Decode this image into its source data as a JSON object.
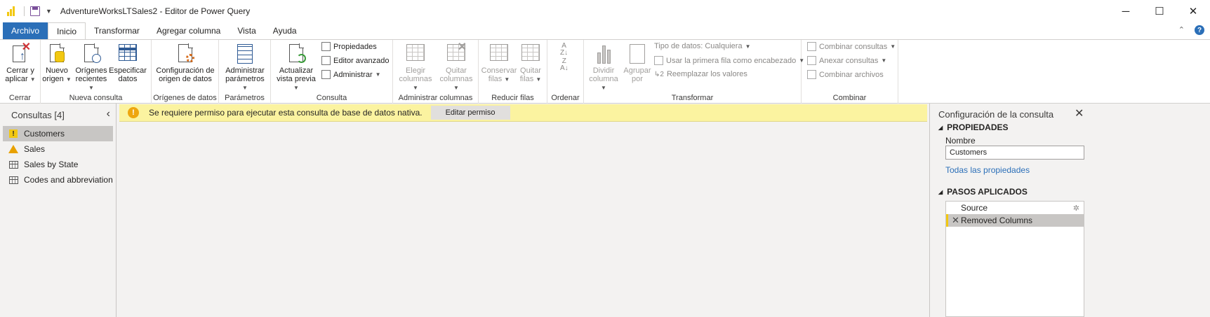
{
  "window": {
    "title": "AdventureWorksLTSales2 - Editor de Power Query",
    "controls": {
      "minimize": "─",
      "maximize": "☐",
      "close": "✕"
    }
  },
  "tabs": [
    {
      "label": "Archivo"
    },
    {
      "label": "Inicio"
    },
    {
      "label": "Transformar"
    },
    {
      "label": "Agregar columna"
    },
    {
      "label": "Vista"
    },
    {
      "label": "Ayuda"
    }
  ],
  "ribbon": {
    "cerrar": {
      "group": "Cerrar",
      "apply_l1": "Cerrar y",
      "apply_l2": "aplicar"
    },
    "nueva": {
      "group": "Nueva consulta",
      "nuevo_l1": "Nuevo",
      "nuevo_l2": "origen",
      "recientes_l1": "Orígenes",
      "recientes_l2": "recientes",
      "especificar_l1": "Especificar",
      "especificar_l2": "datos"
    },
    "origenes": {
      "group": "Orígenes de datos",
      "config_l1": "Configuración de",
      "config_l2": "origen de datos"
    },
    "parametros": {
      "group": "Parámetros",
      "admin_l1": "Administrar",
      "admin_l2": "parámetros"
    },
    "consulta": {
      "group": "Consulta",
      "actualizar_l1": "Actualizar",
      "actualizar_l2": "vista previa",
      "propiedades": "Propiedades",
      "editor": "Editor avanzado",
      "administrar": "Administrar"
    },
    "columnas": {
      "group": "Administrar columnas",
      "elegir_l1": "Elegir",
      "elegir_l2": "columnas",
      "quitar_l1": "Quitar",
      "quitar_l2": "columnas"
    },
    "filas": {
      "group": "Reducir filas",
      "conservar_l1": "Conservar",
      "conservar_l2": "filas",
      "quitar_l1": "Quitar",
      "quitar_l2": "filas"
    },
    "ordenar": {
      "group": "Ordenar"
    },
    "transformar": {
      "group": "Transformar",
      "dividir_l1": "Dividir",
      "dividir_l2": "columna",
      "agrupar_l1": "Agrupar",
      "agrupar_l2": "por",
      "tipo_datos": "Tipo de datos: Cualquiera",
      "primera_fila": "Usar la primera fila como encabezado",
      "reemplazar": "Reemplazar los valores"
    },
    "combinar": {
      "group": "Combinar",
      "combinar_consultas": "Combinar consultas",
      "anexar_consultas": "Anexar consultas",
      "combinar_archivos": "Combinar archivos"
    }
  },
  "queries": {
    "header": "Consultas [4]",
    "items": [
      {
        "label": "Customers",
        "icon": "warning-square-icon"
      },
      {
        "label": "Sales",
        "icon": "warning-triangle-icon"
      },
      {
        "label": "Sales by State",
        "icon": "table-icon"
      },
      {
        "label": "Codes and abbreviations...",
        "icon": "table-icon"
      }
    ]
  },
  "banner": {
    "message": "Se requiere permiso para ejecutar esta consulta de base de datos nativa.",
    "button": "Editar permiso"
  },
  "settings": {
    "title": "Configuración de la consulta",
    "properties_header": "PROPIEDADES",
    "name_label": "Nombre",
    "name_value": "Customers",
    "all_props_link": "Todas las propiedades",
    "steps_header": "PASOS APLICADOS",
    "steps": [
      {
        "label": "Source"
      },
      {
        "label": "Removed Columns"
      }
    ]
  },
  "colors": {
    "file_tab": "#2b6fb8",
    "banner_bg": "#fbf3a0",
    "warning": "#f2c811",
    "link": "#2b6fb8"
  }
}
